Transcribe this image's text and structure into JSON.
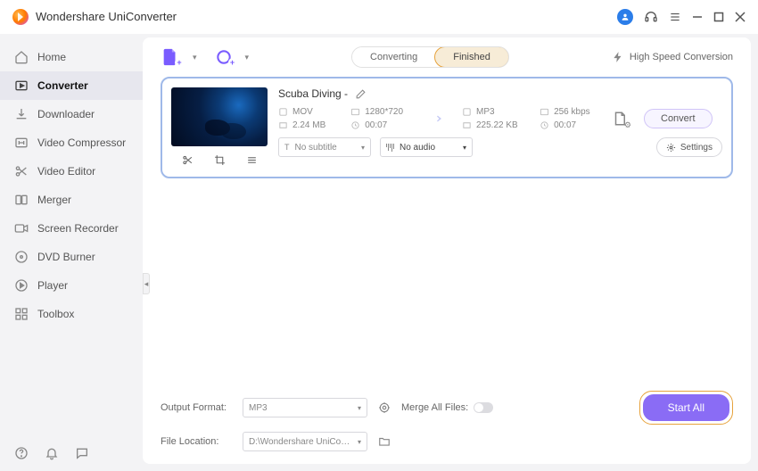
{
  "titlebar": {
    "title": "Wondershare UniConverter"
  },
  "sidebar": {
    "items": [
      {
        "label": "Home",
        "icon": "home"
      },
      {
        "label": "Converter",
        "icon": "converter",
        "active": true
      },
      {
        "label": "Downloader",
        "icon": "downloader"
      },
      {
        "label": "Video Compressor",
        "icon": "compressor"
      },
      {
        "label": "Video Editor",
        "icon": "editor"
      },
      {
        "label": "Merger",
        "icon": "merger"
      },
      {
        "label": "Screen Recorder",
        "icon": "recorder"
      },
      {
        "label": "DVD Burner",
        "icon": "dvd"
      },
      {
        "label": "Player",
        "icon": "player"
      },
      {
        "label": "Toolbox",
        "icon": "toolbox"
      }
    ]
  },
  "topbar": {
    "tabs": {
      "converting": "Converting",
      "finished": "Finished"
    },
    "highspeed": "High Speed Conversion"
  },
  "file": {
    "name": "Scuba Diving -",
    "source": {
      "format": "MOV",
      "resolution": "1280*720",
      "size": "2.24 MB",
      "duration": "00:07"
    },
    "target": {
      "format": "MP3",
      "bitrate": "256 kbps",
      "size": "225.22 KB",
      "duration": "00:07"
    },
    "subtitle_select": "No subtitle",
    "audio_select": "No audio",
    "settings_label": "Settings",
    "convert_label": "Convert"
  },
  "footer": {
    "output_format_label": "Output Format:",
    "output_format_value": "MP3",
    "file_location_label": "File Location:",
    "file_location_value": "D:\\Wondershare UniConverter",
    "merge_label": "Merge All Files:",
    "start_all_label": "Start All"
  }
}
